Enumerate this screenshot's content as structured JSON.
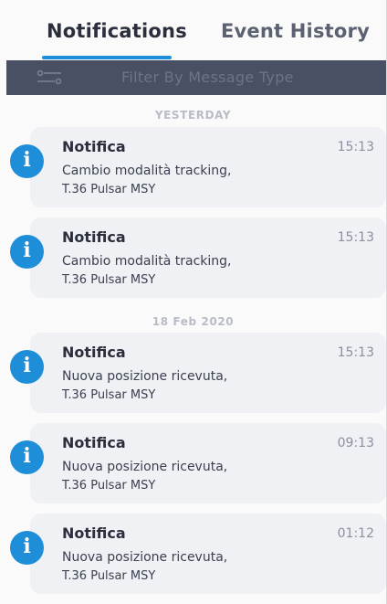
{
  "tabs": [
    {
      "label": "Notifications",
      "active": true
    },
    {
      "label": "Event History",
      "active": false
    }
  ],
  "filter": {
    "label": "Filter By Message Type",
    "icon": "filter-sliders-icon"
  },
  "colors": {
    "accent": "#1e8ed8",
    "filter_bar": "#4a5064",
    "card_bg": "#eff1f5"
  },
  "sections": [
    {
      "header": "YESTERDAY",
      "items": [
        {
          "title": "Notifica",
          "time": "15:13",
          "line1": "Cambio modalità tracking,",
          "line2": "T.36 Pulsar MSY",
          "icon": "info-icon"
        },
        {
          "title": "Notifica",
          "time": "15:13",
          "line1": "Cambio modalità tracking,",
          "line2": "T.36 Pulsar MSY",
          "icon": "info-icon"
        }
      ]
    },
    {
      "header": "18 Feb 2020",
      "items": [
        {
          "title": "Notifica",
          "time": "15:13",
          "line1": "Nuova posizione ricevuta,",
          "line2": "T.36 Pulsar MSY",
          "icon": "info-icon"
        },
        {
          "title": "Notifica",
          "time": "09:13",
          "line1": "Nuova posizione ricevuta,",
          "line2": "T.36 Pulsar MSY",
          "icon": "info-icon"
        },
        {
          "title": "Notifica",
          "time": "01:12",
          "line1": "Nuova posizione ricevuta,",
          "line2": "T.36 Pulsar MSY",
          "icon": "info-icon"
        }
      ]
    }
  ]
}
